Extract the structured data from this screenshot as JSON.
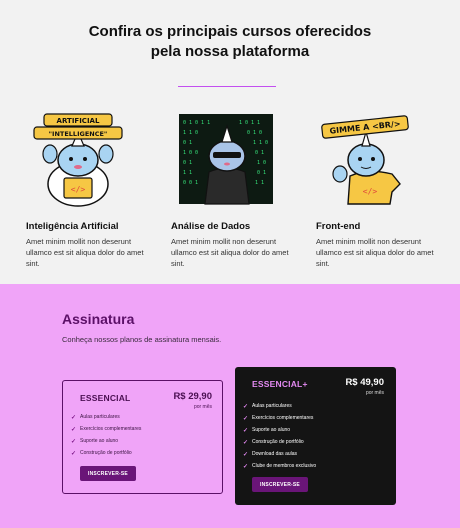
{
  "courses_section": {
    "title_line1": "Confira os principais cursos oferecidos",
    "title_line2": "pela nossa plataforma",
    "accent": "#c34ff0",
    "courses": [
      {
        "name": "Inteligência Artificial",
        "description": "Amet minim mollit non deserunt ullamco est sit aliqua dolor do amet sint.",
        "sticker_text": [
          "ARTIFICIAL",
          "\"INTELLIGENCE\""
        ],
        "icon": "unicorn-ai-sticker"
      },
      {
        "name": "Análise de Dados",
        "description": "Amet minim mollit non deserunt ullamco est sit aliqua dolor do amet sint.",
        "icon": "unicorn-matrix-sticker"
      },
      {
        "name": "Front-end",
        "description": "Amet minim mollit non deserunt ullamco est sit aliqua dolor do amet sint.",
        "sticker_text": [
          "GIMME A <BR/>"
        ],
        "icon": "unicorn-frontend-sticker"
      }
    ]
  },
  "subscription_section": {
    "title": "Assinatura",
    "subtitle": "Conheça nossos planos de assinatura mensais.",
    "background": "#f0a4f8",
    "plans": [
      {
        "name": "ESSENCIAL",
        "price": "R$ 29,90",
        "period": "por mês",
        "features": [
          "Aulas particulares",
          "Exercícios complementares",
          "Suporte ao aluno",
          "Construção de portfólio"
        ],
        "button": "INSCREVER-SE"
      },
      {
        "name": "ESSENCIAL+",
        "price": "R$ 49,90",
        "period": "por mês",
        "features": [
          "Aulas particulares",
          "Exercícios complementares",
          "Suporte ao aluno",
          "Construção de portfólio",
          "Download das aulas",
          "Clube de membros exclusivo"
        ],
        "button": "INSCREVER-SE"
      }
    ]
  }
}
